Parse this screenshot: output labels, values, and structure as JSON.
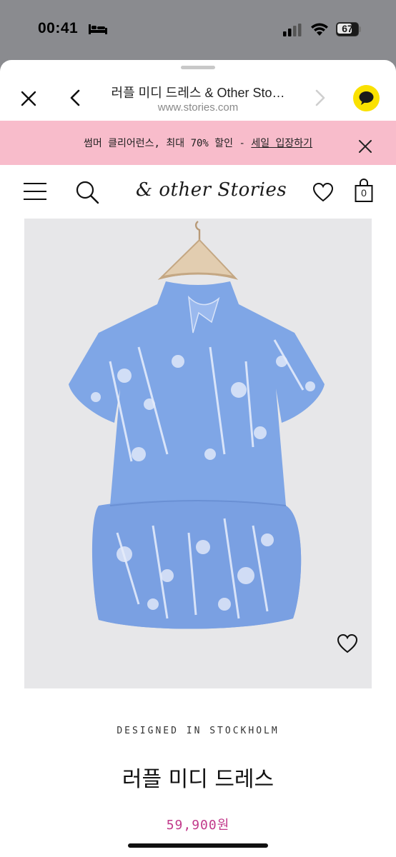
{
  "status_bar": {
    "time": "00:41",
    "battery": "67"
  },
  "browser": {
    "page_title": "러플 미디 드레스 & Other Sto…",
    "url": "www.stories.com"
  },
  "promo": {
    "text": "썸머 클리어런스, 최대 70% 할인 - ",
    "link": "세일 입장하기"
  },
  "header": {
    "logo": "& other Stories",
    "bag_count": "0"
  },
  "product": {
    "tagline": "DESIGNED IN STOCKHOLM",
    "name": "러플 미디 드레스",
    "price": "59,900원",
    "image_desc": "blue floral ruffle dress"
  },
  "icons": [
    "close-icon",
    "back-icon",
    "forward-icon",
    "kakao-chat-icon",
    "menu-icon",
    "search-icon",
    "heart-icon",
    "bag-icon"
  ]
}
